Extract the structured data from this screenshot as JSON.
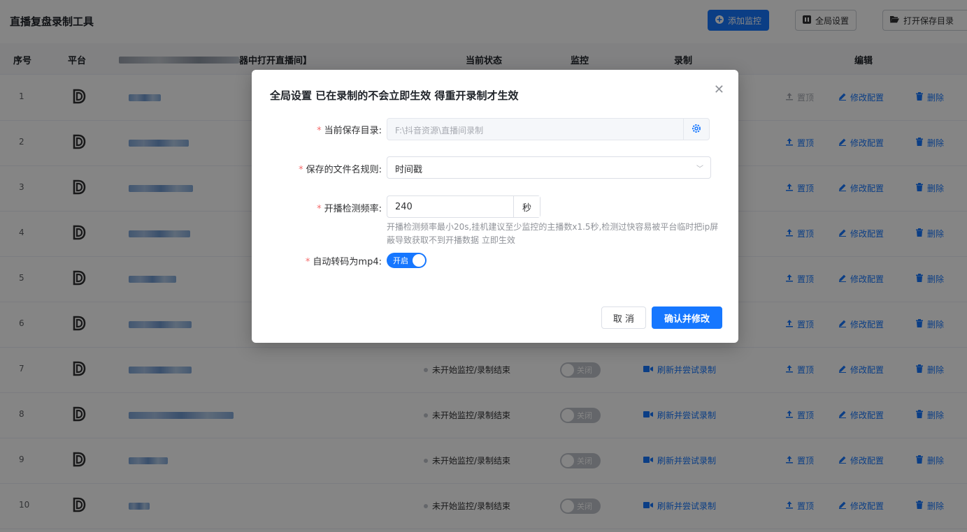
{
  "app": {
    "title": "直播复盘录制工具"
  },
  "toolbar": {
    "add_monitor": "添加监控",
    "global_settings": "全局设置",
    "open_save_dir": "打开保存目录"
  },
  "table": {
    "headers": {
      "index": "序号",
      "platform": "平台",
      "room": "器中打开直播间】",
      "status": "当前状态",
      "monitor": "监控",
      "record": "录制",
      "edit": "编辑"
    },
    "rows": [
      {
        "index": "1",
        "status": "",
        "monitor": "",
        "record": "",
        "pin": "置顶",
        "modify": "修改配置",
        "delete": "删除",
        "pin_disabled": true
      },
      {
        "index": "2",
        "status": "",
        "monitor": "",
        "record": "",
        "pin": "置顶",
        "modify": "修改配置",
        "delete": "删除"
      },
      {
        "index": "3",
        "status": "",
        "monitor": "",
        "record": "",
        "pin": "置顶",
        "modify": "修改配置",
        "delete": "删除"
      },
      {
        "index": "4",
        "status": "",
        "monitor": "",
        "record": "",
        "pin": "置顶",
        "modify": "修改配置",
        "delete": "删除"
      },
      {
        "index": "5",
        "status": "",
        "monitor": "",
        "record": "",
        "pin": "置顶",
        "modify": "修改配置",
        "delete": "删除"
      },
      {
        "index": "6",
        "status": "",
        "monitor": "",
        "record": "",
        "pin": "置顶",
        "modify": "修改配置",
        "delete": "删除"
      },
      {
        "index": "7",
        "status": "未开始监控/录制结束",
        "monitor": "关闭",
        "record": "刷新并尝试录制",
        "pin": "置顶",
        "modify": "修改配置",
        "delete": "删除"
      },
      {
        "index": "8",
        "status": "未开始监控/录制结束",
        "monitor": "关闭",
        "record": "刷新并尝试录制",
        "pin": "置顶",
        "modify": "修改配置",
        "delete": "删除"
      },
      {
        "index": "9",
        "status": "未开始监控/录制结束",
        "monitor": "关闭",
        "record": "刷新并尝试录制",
        "pin": "置顶",
        "modify": "修改配置",
        "delete": "删除"
      },
      {
        "index": "10",
        "status": "未开始监控/录制结束",
        "monitor": "关闭",
        "record": "刷新并尝试录制",
        "pin": "置顶",
        "modify": "修改配置",
        "delete": "删除"
      }
    ]
  },
  "dialog": {
    "title": "全局设置 已在录制的不会立即生效 得重开录制才生效",
    "close_icon": "close-icon",
    "save_dir_label": "当前保存目录:",
    "save_dir_value": "F:\\抖音资源\\直播间录制",
    "filename_rule_label": "保存的文件名规则:",
    "filename_rule_value": "时间戳",
    "check_freq_label": "开播检测频率:",
    "check_freq_value": "240",
    "check_freq_unit": "秒",
    "check_freq_hint": "开播检测频率最小20s,挂机建议至少监控的主播数x1.5秒,检测过快容易被平台临时把ip屏蔽导致获取不到开播数据 立即生效",
    "auto_mp4_label": "自动转码为mp4:",
    "auto_mp4_state": "开启",
    "cancel": "取 消",
    "confirm": "确认并修改"
  },
  "colors": {
    "primary": "#1677ff",
    "required": "#f56c6c",
    "muted": "#909399"
  }
}
